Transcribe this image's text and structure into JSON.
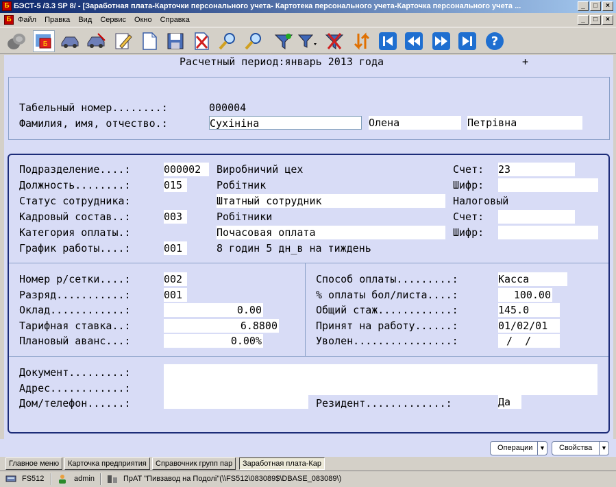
{
  "window": {
    "title": "БЭСТ-5 /3.3 SP 8/ - [Заработная плата-Карточки персонального учета- Картотека персонального учета-Карточка персонального учета ...",
    "app_icon": "Б",
    "btn_min": "_",
    "btn_max": "□",
    "btn_close": "×"
  },
  "menu": [
    "Файл",
    "Правка",
    "Вид",
    "Сервис",
    "Окно",
    "Справка"
  ],
  "toolbar_icons": [
    "coins-icon",
    "company-card-icon",
    "car-icon",
    "car-list-icon",
    "edit-pencil-icon",
    "new-document-icon",
    "save-icon",
    "delete-icon",
    "search-icon",
    "find-next-icon",
    "filter-icon",
    "filter-menu-icon",
    "remove-filter-icon",
    "sort-icon",
    "first-record-icon",
    "previous-record-icon",
    "next-record-icon",
    "last-record-icon",
    "help-icon"
  ],
  "period": {
    "title": "Расчетный период:январь 2013 года",
    "marker": "+"
  },
  "personnel": {
    "tab_label": "Табельный номер........:",
    "tab_value": "000004",
    "fio_label": "Фамилия, имя, отчество.:",
    "surname": "Сухініна",
    "name": "Олена",
    "patronymic": "Петрівна"
  },
  "job": {
    "division_label": "Подразделение....:",
    "division_code": "000002",
    "division_name": "Виробничий цех",
    "position_label": "Должность........:",
    "position_code": "015",
    "position_name": "Робітник",
    "status_label": "Статус сотрудника:",
    "status_value": "Штатный сотрудник",
    "staff_label": "Кадровый состав..:",
    "staff_code": "003",
    "staff_name": "Робітники",
    "paycat_label": "Категория оплаты.:",
    "paycat_value": "Почасовая оплата",
    "schedule_label": "График работы....:",
    "schedule_code": "001",
    "schedule_name": "8 годин 5 дн_в на тиждень",
    "account_label": "Счет:",
    "account_value": "23",
    "cipher_label": "Шифр:",
    "cipher_value": "",
    "tax_label": "Налоговый",
    "tax_account_label": "Счет:",
    "tax_account_value": "",
    "tax_cipher_label": "Шифр:",
    "tax_cipher_value": ""
  },
  "pay": {
    "grid_label": "Номер р/сетки....:",
    "grid_value": "002",
    "grade_label": "Разряд...........:",
    "grade_value": "001",
    "salary_label": "Оклад............:",
    "salary_value": "0.00",
    "rate_label": "Тарифная ставка..:",
    "rate_value": "6.8800",
    "advance_label": "Плановый аванс...:",
    "advance_value": "0.00%",
    "method_label": "Способ оплаты.........:",
    "method_value": "Касса",
    "sick_label": "% оплаты бол/листа....:",
    "sick_value": "100.00",
    "exp_label": "Общий стаж............:",
    "exp_value": "145.0",
    "hired_label": "Принят на работу......:",
    "hired_value": "01/02/01",
    "fired_label": "Уволен................:",
    "fired_value": "/  /"
  },
  "contacts": {
    "doc_label": "Документ.........:",
    "doc_value": "",
    "addr_label": "Адрес............:",
    "addr_value": "",
    "phone_label": "Дом/телефон......:",
    "phone_value": "",
    "resident_label": "Резидент.............:",
    "resident_value": "Да"
  },
  "actions": {
    "operations": "Операции",
    "properties": "Свойства",
    "arrow": "▼"
  },
  "window_tabs": [
    "Главное меню",
    "Карточка предприятия",
    "Справочник групп пар",
    "Заработная плата-Кар"
  ],
  "status": {
    "server": "FS512",
    "user": "admin",
    "company": "ПрАТ \"Пивзавод на Подолі\"(\\\\FS512\\083089$\\DBASE_083089\\)"
  }
}
